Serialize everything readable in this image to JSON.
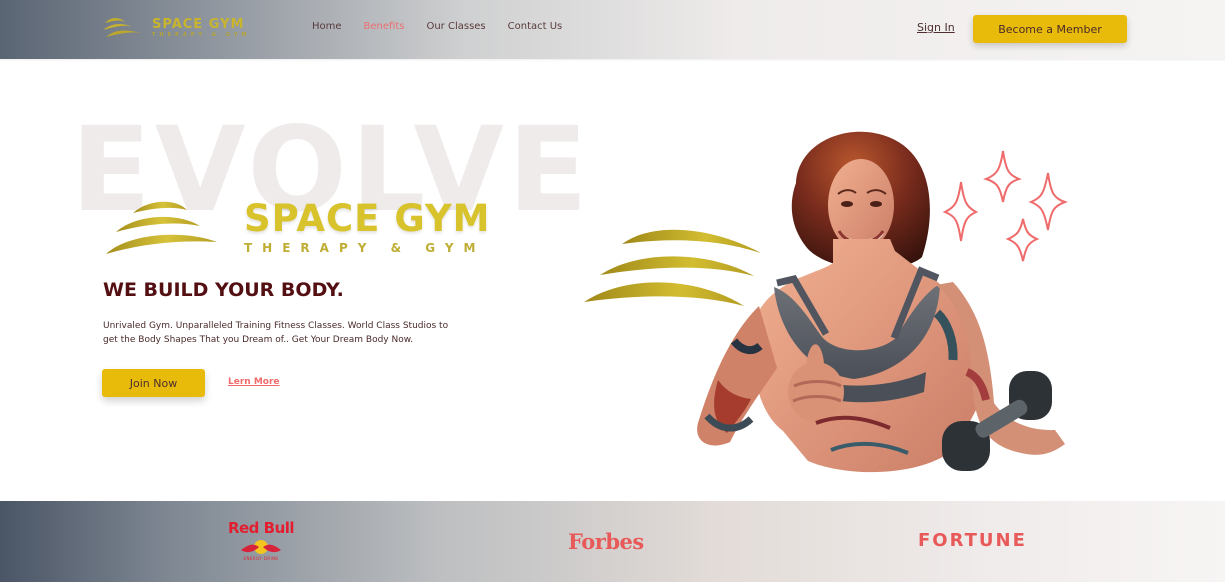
{
  "brand": {
    "name": "SPACE GYM",
    "tagline": "THERAPY & GYM",
    "accent_color": "#d8c32c"
  },
  "nav": {
    "items": [
      {
        "label": "Home"
      },
      {
        "label": "Benefits",
        "active": true
      },
      {
        "label": "Our Classes"
      },
      {
        "label": "Contact Us"
      }
    ]
  },
  "header": {
    "sign_in_label": "Sign In",
    "cta_label": "Become a Member"
  },
  "hero": {
    "watermark": "EVOLVE",
    "logo_name": "SPACE GYM",
    "logo_tagline": "THERAPY & GYM",
    "headline": "WE BUILD YOUR BODY.",
    "description": "Unrivaled Gym. Unparalleled Training Fitness Classes. World Class Studios to get the Body Shapes That you Dream of.. Get Your Dream Body Now.",
    "primary_button": "Join Now",
    "secondary_link": "Lern More"
  },
  "brands": {
    "items": [
      {
        "name": "Red Bull",
        "subtitle": "ENERGY DRINK"
      },
      {
        "name": "Forbes"
      },
      {
        "name": "FORTUNE"
      }
    ]
  },
  "colors": {
    "cta_yellow": "#e8bb0a",
    "headline_maroon": "#530f12",
    "active_nav": "#ec6f6f",
    "logo_coral": "#e85a5a"
  }
}
